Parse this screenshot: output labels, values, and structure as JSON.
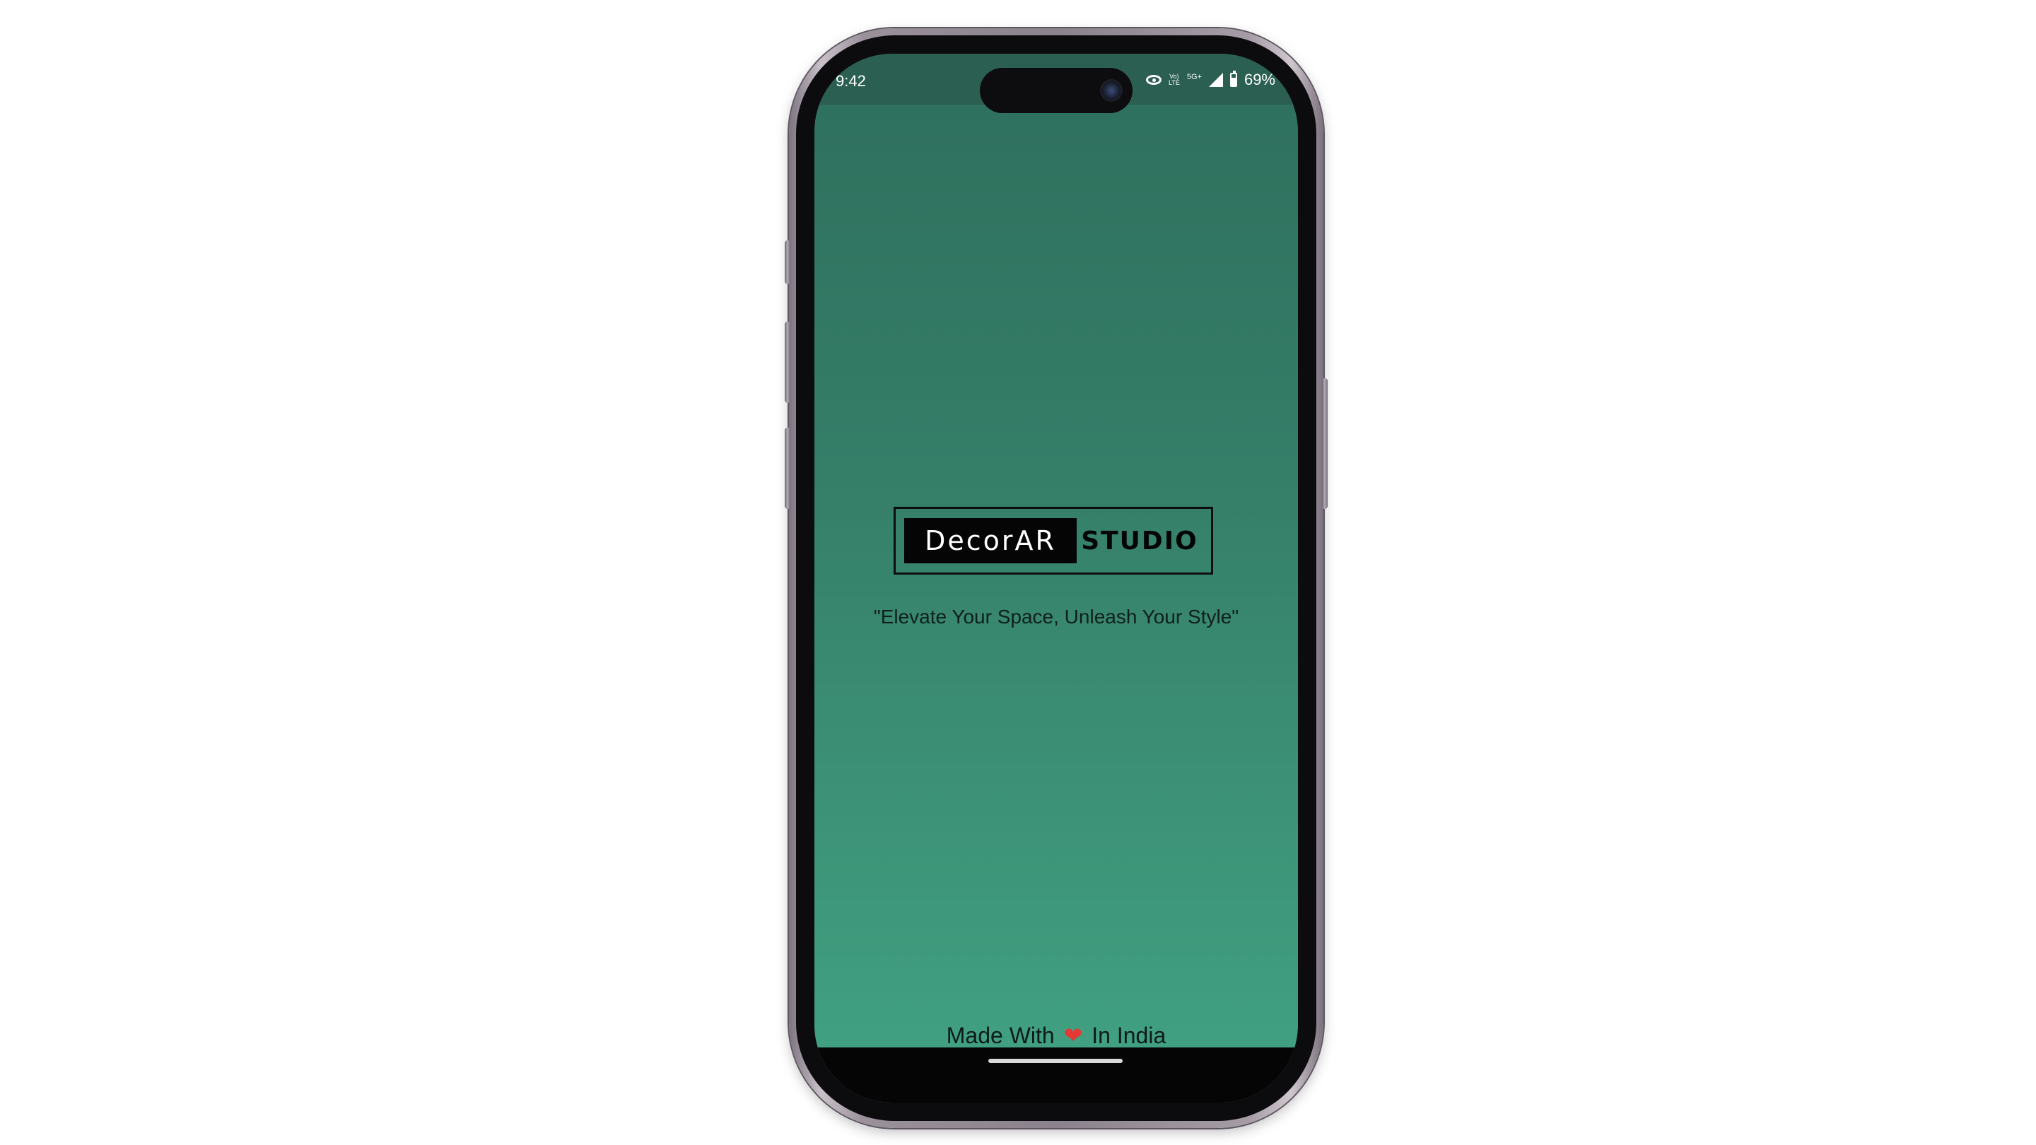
{
  "status_bar": {
    "time": "9:42",
    "network_top": "Vo)",
    "network_bottom": "LTE",
    "network_5g": "5G+",
    "battery": "69%",
    "icons": [
      "eye-icon",
      "signal-icon",
      "battery-icon"
    ]
  },
  "splash": {
    "logo_left": "DecorAR",
    "logo_right": "STUDIO",
    "tagline": "\"Elevate Your Space, Unleash Your Style\"",
    "footer_before": "Made With",
    "footer_heart": "❤",
    "footer_after": "In India"
  },
  "colors": {
    "background_top": "#2e6f5d",
    "background_bottom": "#42a384",
    "heart": "#e53935"
  }
}
